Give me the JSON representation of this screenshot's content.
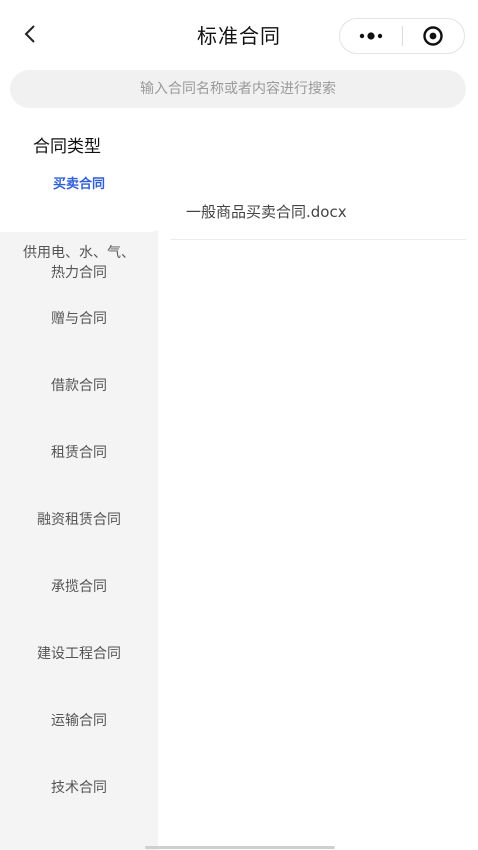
{
  "navbar": {
    "title": "标准合同",
    "back_icon": "chevron-left-icon",
    "more_icon": "more-dots-icon",
    "close_icon": "target-icon"
  },
  "search": {
    "placeholder": "输入合同名称或者内容进行搜索"
  },
  "sidebar": {
    "title": "合同类型",
    "items": [
      {
        "label": "买卖合同",
        "active": true
      },
      {
        "label": "供用电、水、气、",
        "label2": "热力合同",
        "active": false
      },
      {
        "label": "赠与合同",
        "active": false
      },
      {
        "label": "借款合同",
        "active": false
      },
      {
        "label": "租赁合同",
        "active": false
      },
      {
        "label": "融资租赁合同",
        "active": false
      },
      {
        "label": "承揽合同",
        "active": false
      },
      {
        "label": "建设工程合同",
        "active": false
      },
      {
        "label": "运输合同",
        "active": false
      },
      {
        "label": "技术合同",
        "active": false
      }
    ]
  },
  "content": {
    "files": [
      {
        "name": "一般商品买卖合同.docx"
      }
    ]
  },
  "colors": {
    "accent": "#2f5fd6",
    "sidebar_bg": "#f4f4f4",
    "search_bg": "#f1f1f1"
  }
}
